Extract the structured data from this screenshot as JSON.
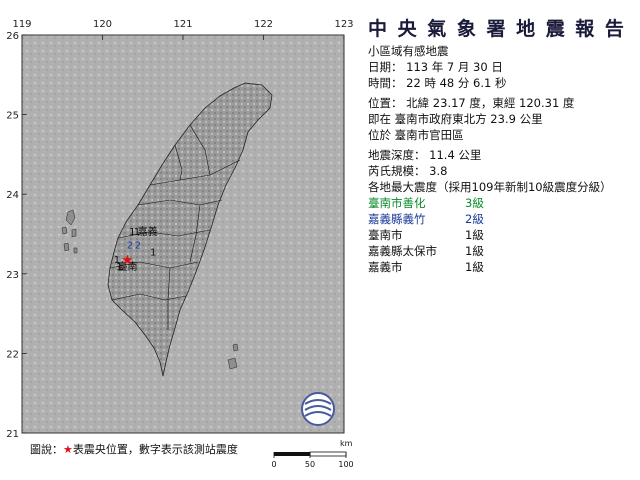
{
  "map": {
    "lon_ticks": [
      "119",
      "120",
      "121",
      "122",
      "123"
    ],
    "lat_ticks": [
      "26",
      "25",
      "24",
      "23",
      "22",
      "21"
    ],
    "epicenter": {
      "lon": 120.31,
      "lat": 23.17,
      "symbol": "★"
    },
    "station_marks": [
      {
        "id": "chiayi-city",
        "text": "1",
        "lon": 120.37,
        "lat": 23.52,
        "color": "#111111"
      },
      {
        "id": "chiayi-county",
        "text": "1",
        "lon": 120.43,
        "lat": 23.52,
        "color": "#111111"
      },
      {
        "id": "chiayi-label",
        "text": "嘉義",
        "lon": 120.56,
        "lat": 23.52,
        "color": "#111111"
      },
      {
        "id": "shanhua-a",
        "text": "2",
        "lon": 120.34,
        "lat": 23.35,
        "color": "#1a3a9a"
      },
      {
        "id": "yizhu",
        "text": "2",
        "lon": 120.44,
        "lat": 23.35,
        "color": "#1a3a9a"
      },
      {
        "id": "taibao",
        "text": "1",
        "lon": 120.63,
        "lat": 23.26,
        "color": "#111111"
      },
      {
        "id": "epi-one",
        "text": "1",
        "lon": 120.18,
        "lat": 23.17,
        "color": "#111111"
      },
      {
        "id": "tainan-one",
        "text": "1",
        "lon": 120.21,
        "lat": 23.08,
        "color": "#111111"
      },
      {
        "id": "tainan-label",
        "text": "臺南",
        "lon": 120.31,
        "lat": 23.08,
        "color": "#111111"
      }
    ]
  },
  "report": {
    "title": "中 央 氣 象 署 地 震 報 告",
    "subtitle": "小區域有感地震",
    "date": "日期： 113 年 7 月 30 日",
    "time": "時間： 22 時 48 分 6.1 秒",
    "position": "位置： 北緯 23.17 度，東經 120.31 度",
    "relative": "即在 臺南市政府東北方 23.9 公里",
    "located_in": "位於 臺南市官田區",
    "depth": "地震深度： 11.4 公里",
    "magnitude": "芮氏規模： 3.8",
    "intensity_header": "各地最大震度（採用109年新制10級震度分級）",
    "intensities": [
      {
        "station": "臺南市善化",
        "level": "3級",
        "color": "#0a8a2a"
      },
      {
        "station": "嘉義縣義竹",
        "level": "2級",
        "color": "#1a3a9a"
      },
      {
        "station": "臺南市",
        "level": "1級",
        "color": "#111111"
      },
      {
        "station": "嘉義縣太保市",
        "level": "1級",
        "color": "#111111"
      },
      {
        "station": "嘉義市",
        "level": "1級",
        "color": "#111111"
      }
    ]
  },
  "legend": {
    "prefix": "圖說：",
    "star": "★",
    "text": "表震央位置，數字表示該測站震度"
  },
  "scale": {
    "unit": "km",
    "ticks": [
      "0",
      "50",
      "100"
    ]
  }
}
